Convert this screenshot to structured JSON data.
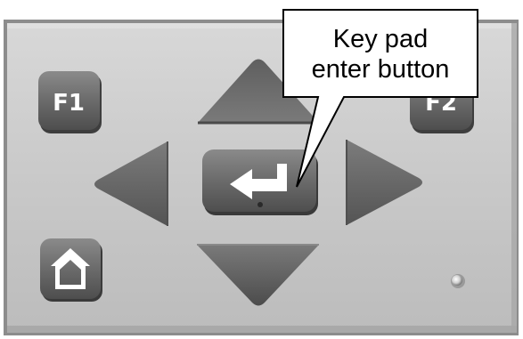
{
  "callout": {
    "line1": "Key pad",
    "line2": "enter button"
  },
  "keypad": {
    "buttons": {
      "f1": "F1",
      "f2": "F2"
    },
    "icons": {
      "up": "triangle-up-icon",
      "down": "triangle-down-icon",
      "left": "triangle-left-icon",
      "right": "triangle-right-icon",
      "enter": "enter-arrow-icon",
      "home": "house-icon"
    }
  },
  "colors": {
    "panel_face": "#c8c8c8",
    "panel_shadow": "#7d7d7d",
    "key": "#6f6f6f",
    "key_dark": "#3f3f3f",
    "symbol": "#ffffff",
    "callout_fill": "#ffffff",
    "callout_border": "#000000"
  }
}
